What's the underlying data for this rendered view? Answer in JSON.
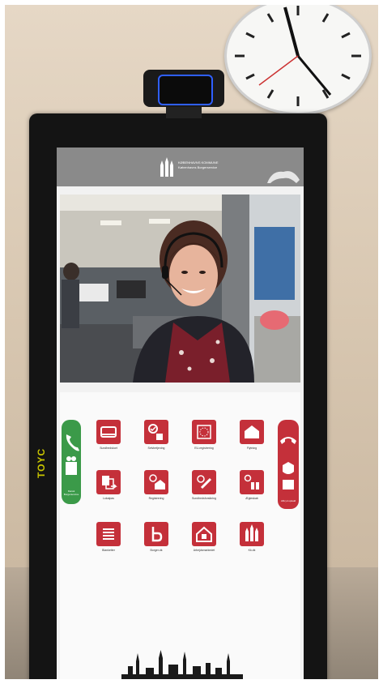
{
  "header": {
    "logo_line1": "KØBENHAVNS KOMMUNE",
    "logo_line2": "Københavns Borgerservice"
  },
  "side_buttons": {
    "left_label": "Dansk Borgerservice",
    "right_label": "Afbryd opkald"
  },
  "tiles": [
    {
      "label": "Sundhedskort",
      "icon": "card-icon"
    },
    {
      "label": "Selvbetjening",
      "icon": "self-service-icon"
    },
    {
      "label": "EU-registrering",
      "icon": "eu-stars-icon"
    },
    {
      "label": "Flytning",
      "icon": "house-icon"
    },
    {
      "label": "Lokalpas",
      "icon": "documents-icon"
    },
    {
      "label": "Registrering",
      "icon": "register-house-icon"
    },
    {
      "label": "Sundhedsforsikring",
      "icon": "health-cross-icon"
    },
    {
      "label": "Ægteskab",
      "icon": "family-icon"
    },
    {
      "label": "Blanketter",
      "icon": "form-lines-icon"
    },
    {
      "label": "Borger.dk",
      "icon": "b-letter-icon"
    },
    {
      "label": "Arbejdsmarkedet",
      "icon": "lock-house-icon"
    },
    {
      "label": "Kk.dk",
      "icon": "towers-icon"
    }
  ],
  "kiosk_brand": "TOYC",
  "colors": {
    "tile_red": "#c4303a",
    "call_green": "#3b9a49",
    "header_gray": "#8a8a8a"
  }
}
